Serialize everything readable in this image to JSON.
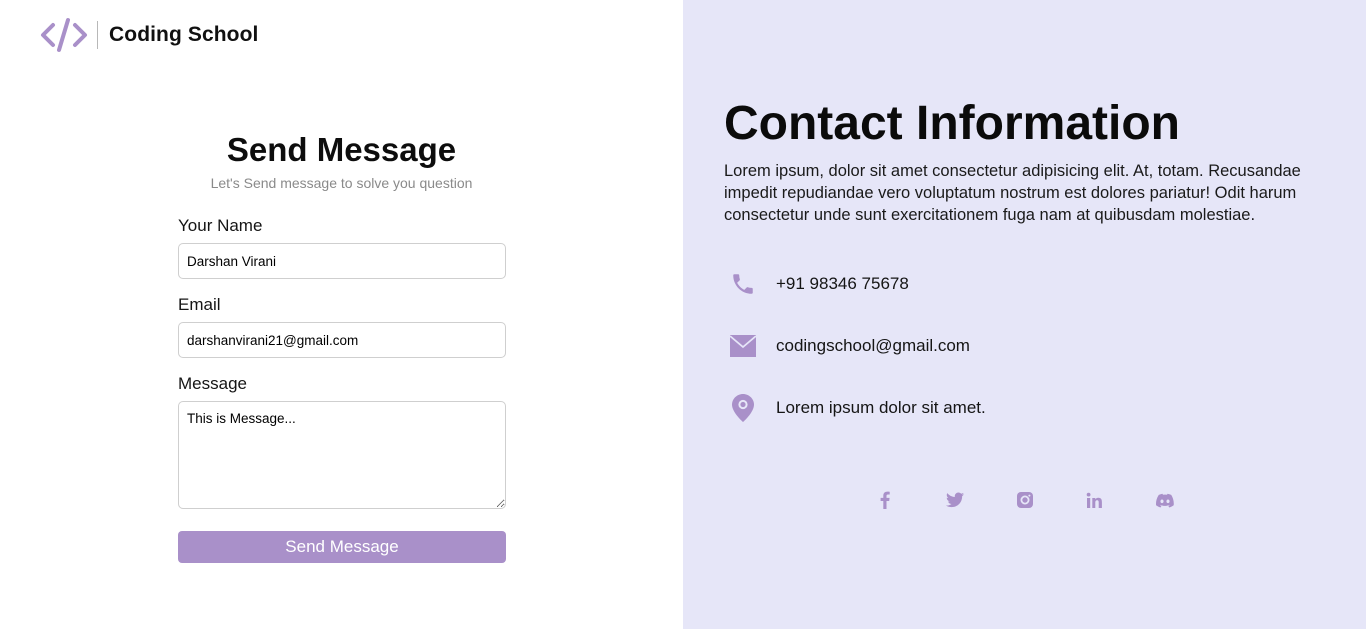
{
  "brand": {
    "name": "Coding School",
    "icon": "code-icon"
  },
  "form": {
    "title": "Send Message",
    "subtitle": "Let's Send message to solve you question",
    "name_label": "Your Name",
    "name_value": "Darshan Virani",
    "email_label": "Email",
    "email_value": "darshanvirani21@gmail.com",
    "message_label": "Message",
    "message_value": "This is Message...",
    "submit_label": "Send Message"
  },
  "contact": {
    "title": "Contact Information",
    "description": "Lorem ipsum, dolor sit amet consectetur adipisicing elit. At, totam. Recusandae impedit repudiandae vero voluptatum nostrum est dolores pariatur! Odit harum consectetur unde sunt exercitationem fuga nam at quibusdam molestiae.",
    "phone": "+91 98346 75678",
    "email": "codingschool@gmail.com",
    "address": "Lorem ipsum dolor sit amet."
  },
  "socials": [
    "facebook-icon",
    "twitter-icon",
    "instagram-icon",
    "linkedin-icon",
    "discord-icon"
  ],
  "colors": {
    "accent": "#a990c9",
    "panel_bg": "#e6e6f8",
    "page_bg": "#ffffff"
  }
}
